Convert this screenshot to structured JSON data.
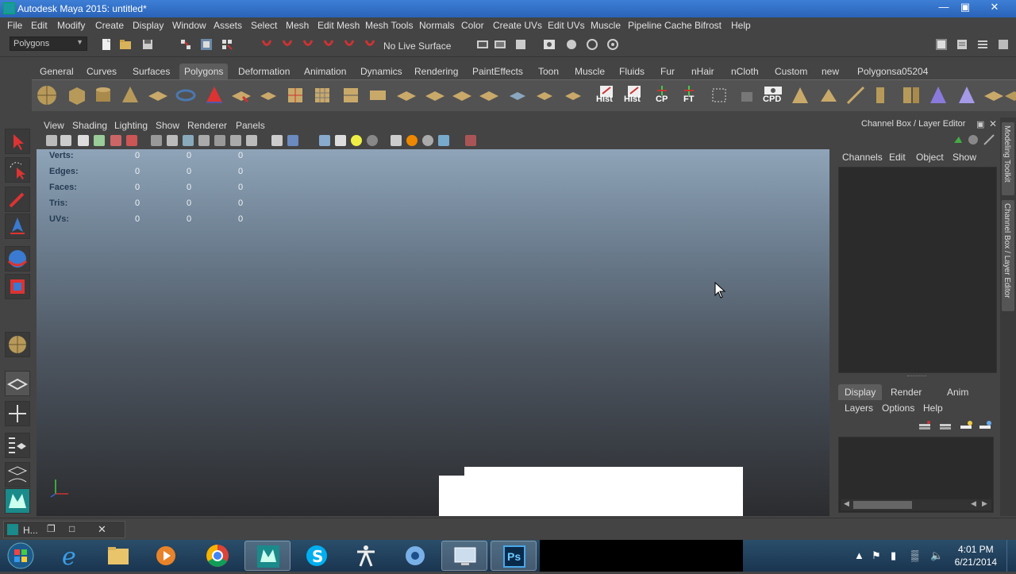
{
  "window": {
    "title": "Autodesk Maya 2015: untitled*",
    "minimize": "—",
    "restore": "▣",
    "close": "✕"
  },
  "menubar": [
    "File",
    "Edit",
    "Modify",
    "Create",
    "Display",
    "Window",
    "Assets",
    "Select",
    "Mesh",
    "Edit Mesh",
    "Mesh Tools",
    "Normals",
    "Color",
    "Create UVs",
    "Edit UVs",
    "Muscle",
    "Pipeline Cache",
    "Bifrost",
    "Help"
  ],
  "statusline": {
    "menuset": "Polygons",
    "live_surface": "No Live Surface"
  },
  "shelf": {
    "tabs": [
      "General",
      "Curves",
      "Surfaces",
      "Polygons",
      "Deformation",
      "Animation",
      "Dynamics",
      "Rendering",
      "PaintEffects",
      "Toon",
      "Muscle",
      "Fluids",
      "Fur",
      "nHair",
      "nCloth",
      "Custom",
      "new",
      "Polygonsa05204"
    ],
    "active_tab": "Polygons",
    "labels": [
      "Hist",
      "Hist",
      "CP",
      "FT",
      "CPD"
    ]
  },
  "panel": {
    "menus": [
      "View",
      "Shading",
      "Lighting",
      "Show",
      "Renderer",
      "Panels"
    ]
  },
  "hud": {
    "rows": [
      {
        "label": "Verts:",
        "a": "0",
        "b": "0",
        "c": "0"
      },
      {
        "label": "Edges:",
        "a": "0",
        "b": "0",
        "c": "0"
      },
      {
        "label": "Faces:",
        "a": "0",
        "b": "0",
        "c": "0"
      },
      {
        "label": "Tris:",
        "a": "0",
        "b": "0",
        "c": "0"
      },
      {
        "label": "UVs:",
        "a": "0",
        "b": "0",
        "c": "0"
      }
    ]
  },
  "channelbox": {
    "title": "Channel Box / Layer Editor",
    "menus": [
      "Channels",
      "Edit",
      "Object",
      "Show"
    ]
  },
  "layer_editor": {
    "tabs": [
      "Display",
      "Render",
      "Anim"
    ],
    "active_tab": "Display",
    "menus": [
      "Layers",
      "Options",
      "Help"
    ]
  },
  "side_tabs": [
    "Modeling Toolkit",
    "Channel Box / Layer Editor"
  ],
  "bottom": {
    "minimized_window": "H..."
  },
  "taskbar": {
    "time": "4:01 PM",
    "date": "6/21/2014",
    "photoshop_label": "Ps"
  }
}
